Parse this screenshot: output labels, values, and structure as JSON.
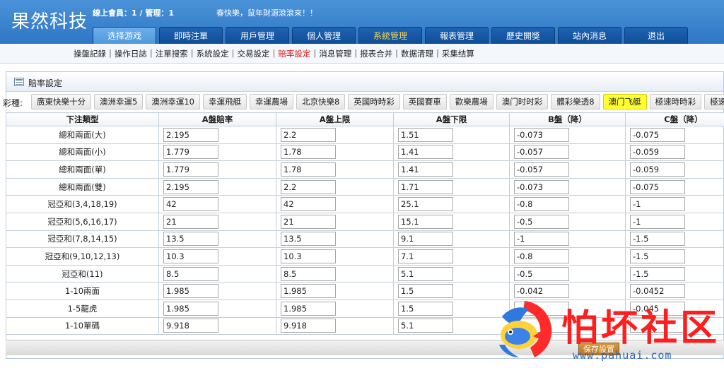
{
  "header": {
    "logo": "果然科技",
    "online_stats": "線上會員：1 / 管理：1",
    "marquee": "春快樂，鼠年財源滾滾來！！"
  },
  "main_nav": [
    {
      "label": "选择游戏",
      "selected": true
    },
    {
      "label": "即時注單"
    },
    {
      "label": "用戶管理"
    },
    {
      "label": "個人管理"
    },
    {
      "label": "系統管理",
      "accent": true
    },
    {
      "label": "報表管理"
    },
    {
      "label": "歷史開獎"
    },
    {
      "label": "站內消息"
    },
    {
      "label": "退出"
    }
  ],
  "sub_nav": [
    {
      "label": "操盤記錄"
    },
    {
      "label": "操作日誌"
    },
    {
      "label": "注單搜索"
    },
    {
      "label": "系統設定"
    },
    {
      "label": "交易設定"
    },
    {
      "label": "賠率設定",
      "active": true
    },
    {
      "label": "消息管理"
    },
    {
      "label": "报表合并"
    },
    {
      "label": "数据清理"
    },
    {
      "label": "采集结算"
    }
  ],
  "panel": {
    "title": "賠率設定"
  },
  "lottery": {
    "label": "彩種:",
    "tabs": [
      {
        "label": "廣東快樂十分"
      },
      {
        "label": "澳洲幸運5"
      },
      {
        "label": "澳洲幸運10"
      },
      {
        "label": "幸運飛艇"
      },
      {
        "label": "幸運農場"
      },
      {
        "label": "北京快樂8"
      },
      {
        "label": "英國時時彩"
      },
      {
        "label": "英國賽車"
      },
      {
        "label": "歡樂農場"
      },
      {
        "label": "澳门时时彩"
      },
      {
        "label": "體彩樂透8"
      },
      {
        "label": "澳门飞艇",
        "selected": true
      },
      {
        "label": "極速時時彩"
      },
      {
        "label": "極速賽車"
      }
    ]
  },
  "table": {
    "headers": [
      "下注類型",
      "A盤賠率",
      "A盤上限",
      "A盤下限",
      "B盤（降）",
      "C盤（降）"
    ],
    "rows": [
      {
        "type": "總和兩面(大)",
        "a_odds": "2.195",
        "a_max": "2.2",
        "a_min": "1.51",
        "b_down": "-0.073",
        "c_down": "-0.075"
      },
      {
        "type": "總和兩面(小)",
        "a_odds": "1.779",
        "a_max": "1.78",
        "a_min": "1.41",
        "b_down": "-0.057",
        "c_down": "-0.059"
      },
      {
        "type": "總和兩面(單)",
        "a_odds": "1.779",
        "a_max": "1.78",
        "a_min": "1.41",
        "b_down": "-0.057",
        "c_down": "-0.059"
      },
      {
        "type": "總和兩面(雙)",
        "a_odds": "2.195",
        "a_max": "2.2",
        "a_min": "1.71",
        "b_down": "-0.073",
        "c_down": "-0.075"
      },
      {
        "type": "冠亞和(3,4,18,19)",
        "a_odds": "42",
        "a_max": "42",
        "a_min": "25.1",
        "b_down": "-0.8",
        "c_down": "-1"
      },
      {
        "type": "冠亞和(5,6,16,17)",
        "a_odds": "21",
        "a_max": "21",
        "a_min": "15.1",
        "b_down": "-0.5",
        "c_down": "-1"
      },
      {
        "type": "冠亞和(7,8,14,15)",
        "a_odds": "13.5",
        "a_max": "13.5",
        "a_min": "9.1",
        "b_down": "-1",
        "c_down": "-1.5"
      },
      {
        "type": "冠亞和(9,10,12,13)",
        "a_odds": "10.3",
        "a_max": "10.3",
        "a_min": "7.1",
        "b_down": "-0.8",
        "c_down": "-1.5"
      },
      {
        "type": "冠亞和(11)",
        "a_odds": "8.5",
        "a_max": "8.5",
        "a_min": "5.1",
        "b_down": "-0.5",
        "c_down": "-1.5"
      },
      {
        "type": "1-10兩面",
        "a_odds": "1.985",
        "a_max": "1.985",
        "a_min": "1.5",
        "b_down": "-0.042",
        "c_down": "-0.0452"
      },
      {
        "type": "1-5龍虎",
        "a_odds": "1.985",
        "a_max": "1.985",
        "a_min": "1.5",
        "b_down": "",
        "c_down": "-0.045"
      },
      {
        "type": "1-10單碼",
        "a_odds": "9.918",
        "a_max": "9.918",
        "a_min": "5.1",
        "b_down": "",
        "c_down": ""
      }
    ]
  },
  "actions": {
    "save_label": "保存設置"
  },
  "watermark": {
    "text": "怕坏社区",
    "url": "www.pahuai.com"
  },
  "colors": {
    "header_blue": "#3a83cd",
    "nav_tab": "#155aa7",
    "active_link": "#d4231c",
    "selected_lottery": "#ffff33",
    "watermark_red": "#ff1e1e"
  }
}
